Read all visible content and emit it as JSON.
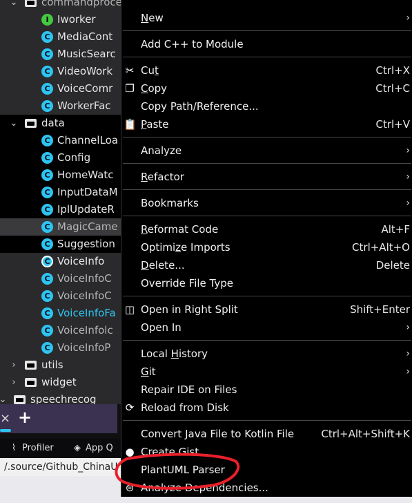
{
  "tree": [
    {
      "indent": 1,
      "kind": "folder",
      "label": "commandprocessor",
      "expanded": true,
      "style": "muted"
    },
    {
      "indent": 2,
      "kind": "class",
      "badge": "I",
      "variant": "green",
      "label": "Iworker"
    },
    {
      "indent": 2,
      "kind": "class",
      "badge": "C",
      "label": "MediaCont"
    },
    {
      "indent": 2,
      "kind": "class",
      "badge": "C",
      "label": "MusicSearc"
    },
    {
      "indent": 2,
      "kind": "class",
      "badge": "C",
      "label": "VideoWork"
    },
    {
      "indent": 2,
      "kind": "class",
      "badge": "C",
      "label": "VoiceComr"
    },
    {
      "indent": 2,
      "kind": "class",
      "badge": "C",
      "label": "WorkerFac"
    },
    {
      "indent": 1,
      "kind": "folder",
      "label": "data",
      "expanded": true
    },
    {
      "indent": 2,
      "kind": "class",
      "badge": "C",
      "label": "ChannelLoa"
    },
    {
      "indent": 2,
      "kind": "class",
      "badge": "C",
      "label": "Config"
    },
    {
      "indent": 2,
      "kind": "class",
      "badge": "C",
      "label": "HomeWatc"
    },
    {
      "indent": 2,
      "kind": "class",
      "badge": "C",
      "label": "InputDataM"
    },
    {
      "indent": 2,
      "kind": "class",
      "badge": "C",
      "label": "IplUpdateR"
    },
    {
      "indent": 2,
      "kind": "class",
      "badge": "C",
      "label": "MagicCame",
      "state": "selected",
      "style": "muted"
    },
    {
      "indent": 2,
      "kind": "class",
      "badge": "C",
      "label": "Suggestion"
    },
    {
      "indent": 2,
      "kind": "class",
      "badge": "C",
      "variant": "ring",
      "label": "VoiceInfo"
    },
    {
      "indent": 2,
      "kind": "class",
      "badge": "C",
      "label": "VoiceInfoC",
      "style": "muted"
    },
    {
      "indent": 2,
      "kind": "class",
      "badge": "C",
      "label": "VoiceInfoC",
      "style": "muted"
    },
    {
      "indent": 2,
      "kind": "class",
      "badge": "C",
      "label": "VoiceInfoFa",
      "style": "blue"
    },
    {
      "indent": 2,
      "kind": "class",
      "badge": "C",
      "label": "VoiceInfolc",
      "style": "muted"
    },
    {
      "indent": 2,
      "kind": "class",
      "badge": "C",
      "label": "VoiceInfoP",
      "style": "muted"
    },
    {
      "indent": 1,
      "kind": "folder",
      "label": "utils",
      "expanded": false
    },
    {
      "indent": 1,
      "kind": "folder",
      "label": "widget",
      "expanded": false
    },
    {
      "indent": 0,
      "kind": "folder",
      "label": "speechrecog",
      "expanded": true
    }
  ],
  "bottom": {
    "tab_close": "×",
    "tab_add": "+",
    "tools": [
      {
        "icon": "profiler-icon",
        "glyph": "⌇",
        "label": "Profiler"
      },
      {
        "icon": "app-inspection-icon",
        "glyph": "◈",
        "label": "App Q"
      }
    ],
    "path": "/.source/Github_ChinaU"
  },
  "menu": {
    "items": [
      {
        "id": "new",
        "label": "New",
        "mnemonic": "N",
        "submenu": true
      },
      {
        "sep": true
      },
      {
        "id": "add-cpp-to-module",
        "label": "Add C++ to Module"
      },
      {
        "sep": true
      },
      {
        "id": "cut",
        "label": "Cut",
        "mnemonic": "t",
        "icon": "scissors-icon",
        "glyph": "✂",
        "shortcut": "Ctrl+X"
      },
      {
        "id": "copy",
        "label": "Copy",
        "mnemonic": "C",
        "icon": "copy-icon",
        "glyph": "❐",
        "shortcut": "Ctrl+C"
      },
      {
        "id": "copy-path-reference",
        "label": "Copy Path/Reference..."
      },
      {
        "id": "paste",
        "label": "Paste",
        "mnemonic": "P",
        "icon": "clipboard-icon",
        "glyph": "📋",
        "shortcut": "Ctrl+V"
      },
      {
        "sep": true
      },
      {
        "id": "analyze",
        "label": "Analyze",
        "submenu": true
      },
      {
        "sep": true
      },
      {
        "id": "refactor",
        "label": "Refactor",
        "mnemonic": "R",
        "submenu": true
      },
      {
        "sep": true
      },
      {
        "id": "bookmarks",
        "label": "Bookmarks",
        "submenu": true
      },
      {
        "sep": true
      },
      {
        "id": "reformat-code",
        "label": "Reformat Code",
        "mnemonic": "R",
        "shortcut": "Alt+F"
      },
      {
        "id": "optimize-imports",
        "label": "Optimize Imports",
        "mnemonic": "z",
        "shortcut": "Ctrl+Alt+O"
      },
      {
        "id": "delete",
        "label": "Delete...",
        "mnemonic": "D",
        "shortcut": "Delete"
      },
      {
        "id": "override-file-type",
        "label": "Override File Type"
      },
      {
        "sep": true
      },
      {
        "id": "open-in-right-split",
        "label": "Open in Right Split",
        "icon": "split-icon",
        "glyph": "◫",
        "shortcut": "Shift+Enter"
      },
      {
        "id": "open-in",
        "label": "Open In",
        "submenu": true
      },
      {
        "sep": true
      },
      {
        "id": "local-history",
        "label": "Local History",
        "mnemonic": "H",
        "submenu": true
      },
      {
        "id": "git",
        "label": "Git",
        "mnemonic": "G",
        "submenu": true
      },
      {
        "id": "repair-ide-on-files",
        "label": "Repair IDE on Files"
      },
      {
        "id": "reload-from-disk",
        "label": "Reload from Disk",
        "icon": "reload-icon",
        "glyph": "⟳"
      },
      {
        "sep": true
      },
      {
        "id": "convert-java-to-kotlin",
        "label": "Convert Java File to Kotlin File",
        "shortcut": "Ctrl+Alt+Shift+K"
      },
      {
        "id": "create-gist",
        "label": "Create Gist...",
        "icon": "github-icon",
        "glyph": "●"
      },
      {
        "id": "plantuml-parser",
        "label": "PlantUML Parser"
      },
      {
        "id": "analyze-dependencies",
        "label": "Analyze Dependencies...",
        "icon": "dependencies-icon",
        "glyph": "⊜"
      }
    ],
    "submenu_arrow": "›"
  },
  "colors": {
    "annotation": "#e8202a",
    "class_icon": "#2ec4f1",
    "interface_icon": "#44c840"
  }
}
